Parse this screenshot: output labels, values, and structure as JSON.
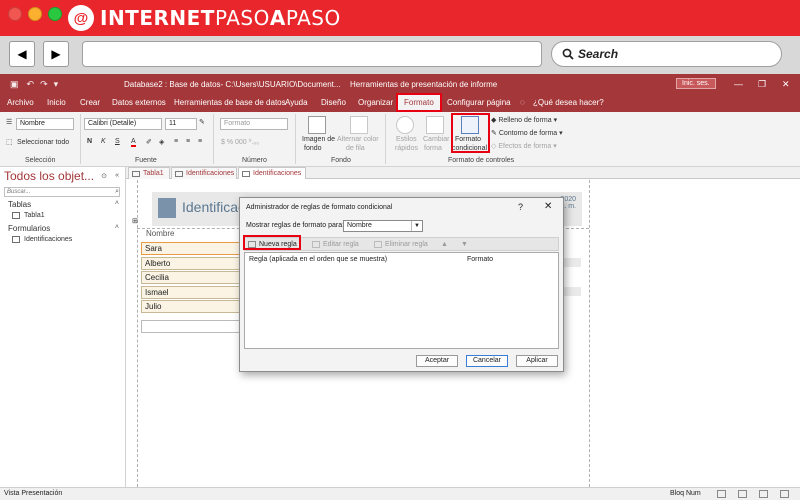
{
  "brand": {
    "logo_letter": "@",
    "name_part1": "INTERNET",
    "name_part2": "PASO",
    "name_part3": "A",
    "name_part4": "PASO",
    "color": "#e9262b"
  },
  "browser": {
    "back_icon": "◀",
    "forward_icon": "▶",
    "search_label": "Search",
    "url": ""
  },
  "app": {
    "title_doc": "Database2 : Base de datos- C:\\Users\\USUARIO\\Document...",
    "title_tools": "Herramientas de presentación de informe",
    "signin": "Inic. ses.",
    "accent": "#a4373a"
  },
  "menu": {
    "items": [
      "Archivo",
      "Inicio",
      "Crear",
      "Datos externos",
      "Herramientas de base de datos",
      "Ayuda",
      "Diseño",
      "Organizar",
      "Formato",
      "Configurar página"
    ],
    "tell_me": "¿Qué desea hacer?"
  },
  "ribbon": {
    "seleccion": {
      "object": "Nombre",
      "select_all": "Seleccionar todo",
      "group": "Selección"
    },
    "fuente": {
      "font": "Calibri (Detalle)",
      "size": "11",
      "bold": "N",
      "italic": "K",
      "underline": "S",
      "font_color": "A",
      "group": "Fuente"
    },
    "numero": {
      "format": "Formato",
      "group": "Número"
    },
    "fondo": {
      "bg_image_1": "Imagen de",
      "bg_image_2": "fondo",
      "alt_color_1": "Alternar color",
      "alt_color_2": "de fila",
      "group": "Fondo"
    },
    "controles": {
      "styles_1": "Estilos",
      "styles_2": "rápidos",
      "change_1": "Cambiar",
      "change_2": "forma",
      "cond_1": "Formato",
      "cond_2": "condicional",
      "fill": "Relleno de forma",
      "outline": "Contorno de forma",
      "effects": "Efectos de forma",
      "group": "Formato de controles"
    }
  },
  "navpane": {
    "title": "Todos los objet...",
    "search_placeholder": "Buscar...",
    "sections": [
      {
        "name": "Tablas",
        "items": [
          "Tabla1"
        ]
      },
      {
        "name": "Formularios",
        "items": [
          "Identificaciones"
        ]
      }
    ]
  },
  "tabs": [
    "Tabla1",
    "Identificaciones",
    "Identificaciones"
  ],
  "form": {
    "title": "Identificac",
    "date_1": "2020",
    "date_2": "a. m.",
    "field_label": "Nombre",
    "rows": [
      "Sara",
      "Alberto",
      "Cecilia",
      "Ismael",
      "Julio",
      ""
    ]
  },
  "dialog": {
    "title": "Administrador de reglas de formato condicional",
    "help": "?",
    "close": "✕",
    "show_label": "Mostrar reglas de formato para:",
    "show_value": "Nombre",
    "new_rule": "Nueva regla",
    "edit_rule": "Editar regla",
    "delete_rule": "Eliminar regla",
    "col_rule": "Regla (aplicada en el orden que se muestra)",
    "col_format": "Formato",
    "accept": "Aceptar",
    "cancel": "Cancelar",
    "apply": "Aplicar"
  },
  "status": {
    "left": "Vista Presentación",
    "right": "Bloq Num"
  }
}
